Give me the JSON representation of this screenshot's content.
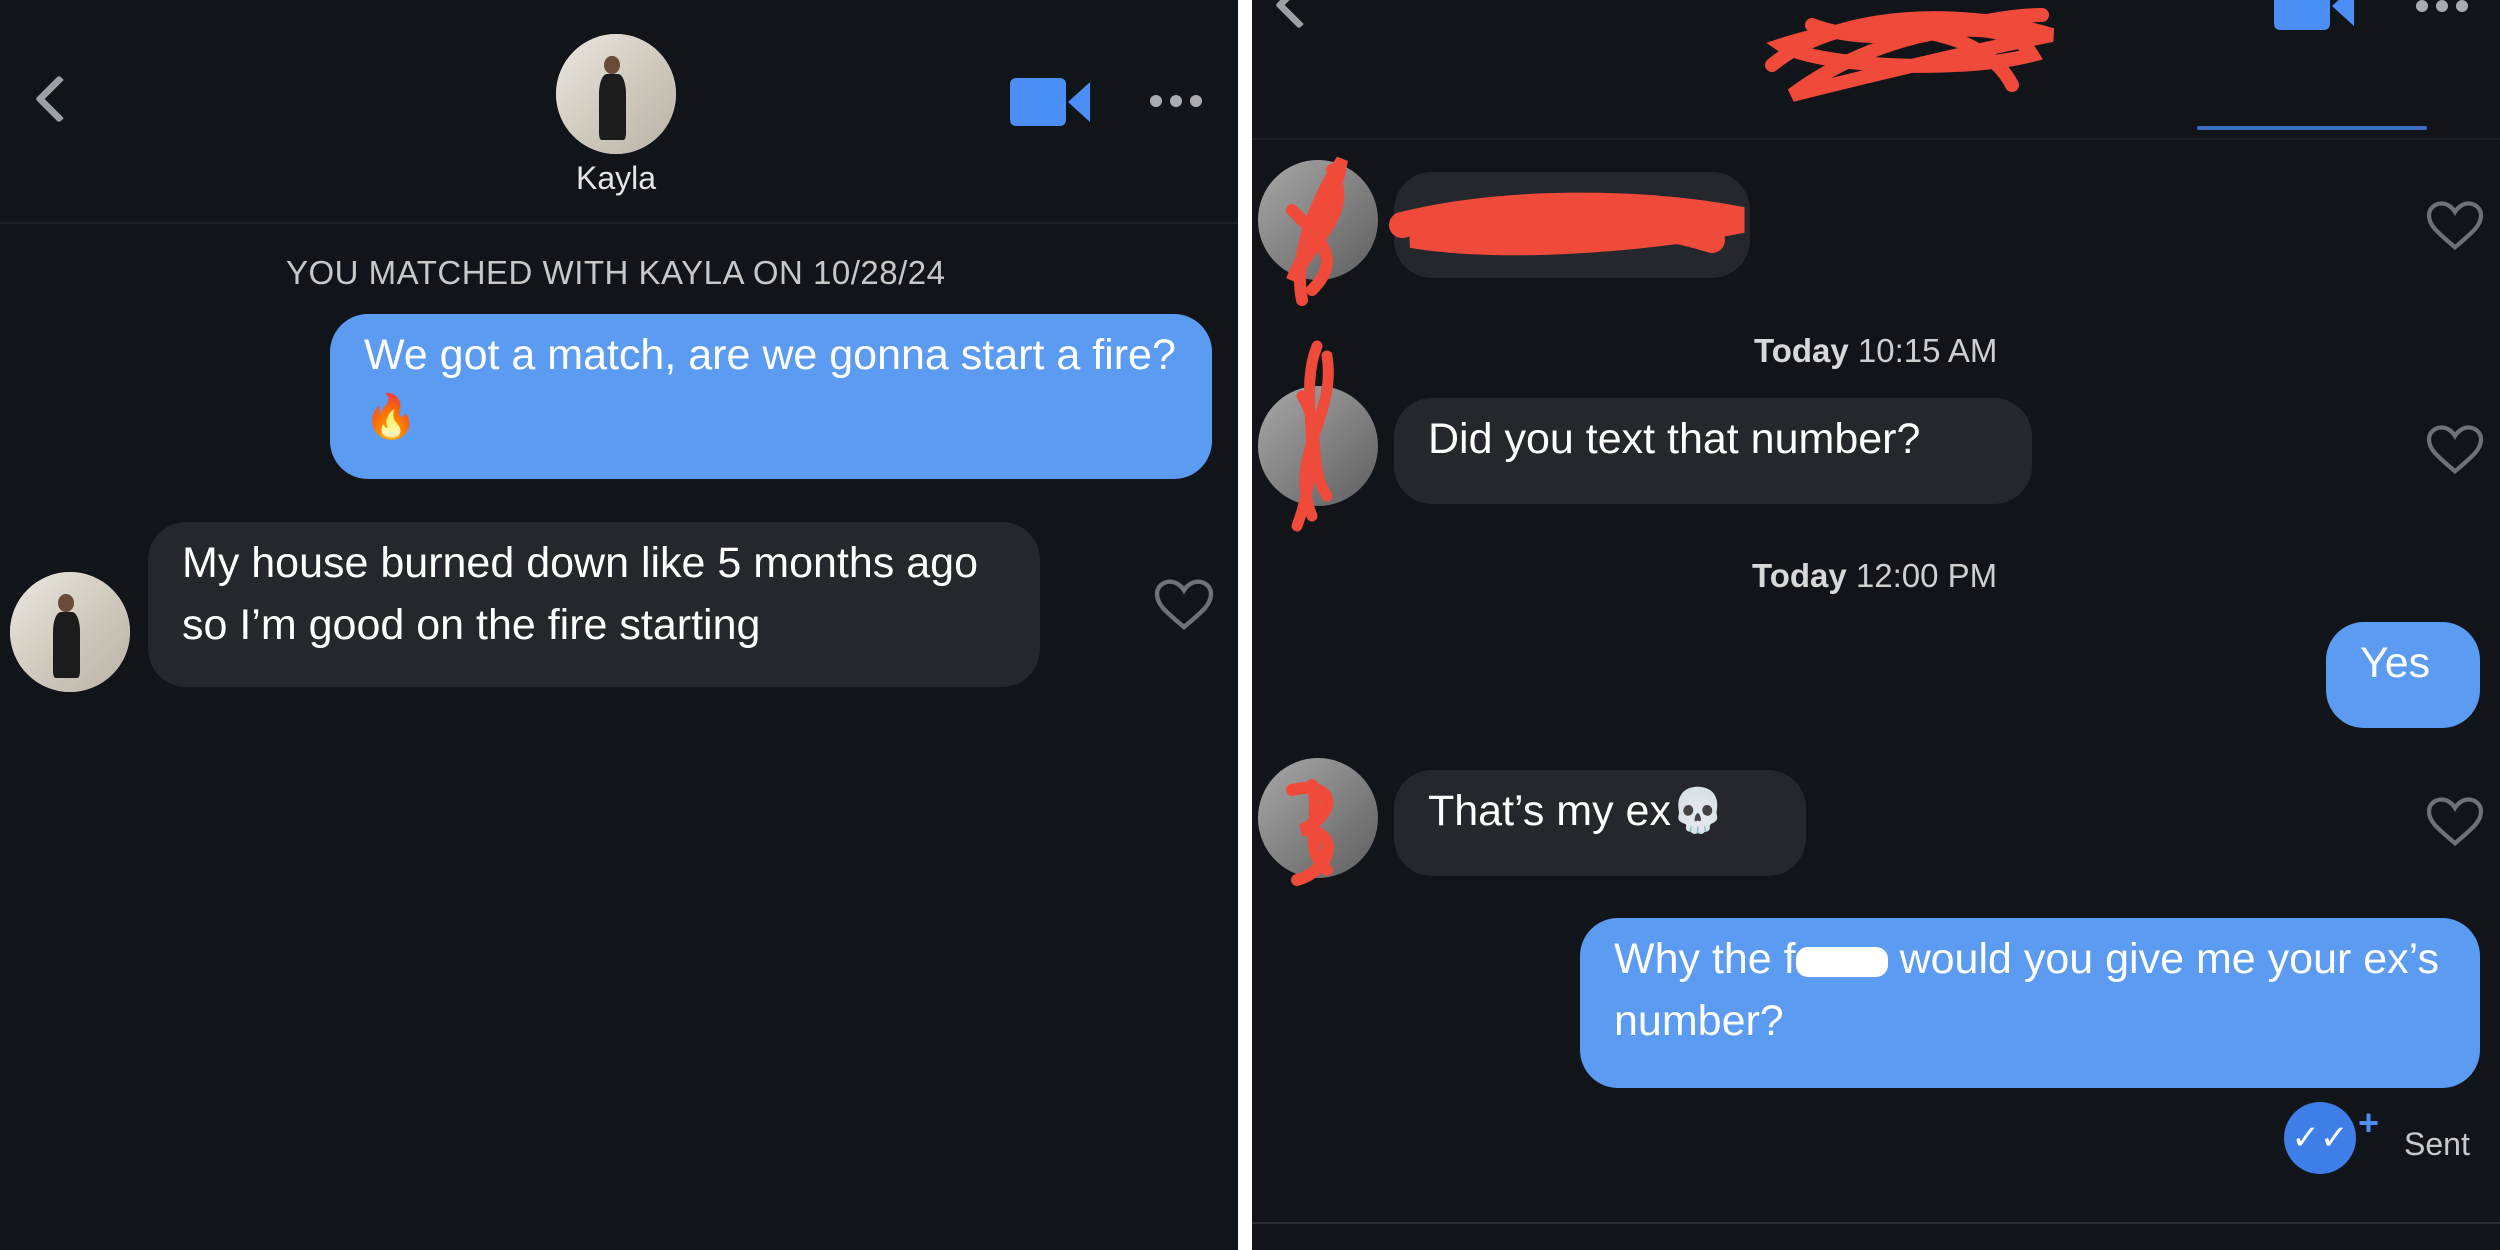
{
  "left": {
    "header": {
      "name": "Kayla",
      "back_icon": "chevron-left-icon",
      "video_icon": "video-camera-icon",
      "more_icon": "more-dots-icon"
    },
    "match_banner": "YOU MATCHED WITH KAYLA ON 10/28/24",
    "messages": [
      {
        "direction": "sent",
        "text": "We got a match, are we gonna start a fire?",
        "emoji": "🔥"
      },
      {
        "direction": "received",
        "text": "My house burned down like 5 months ago so I’m good on the fire starting"
      }
    ]
  },
  "right": {
    "messages_top": {
      "direction": "received",
      "text": "",
      "note": "censored"
    },
    "ts1": {
      "day": "Today",
      "time": "10:15 AM"
    },
    "msg_did_you_text": "Did you text that number?",
    "ts2": {
      "day": "Today",
      "time": "12:00 PM"
    },
    "msg_yes": "Yes",
    "msg_ex": "That’s my ex",
    "msg_ex_emoji": "💀",
    "msg_why_part1": "Why the f",
    "msg_why_part2": " would you give me your ex’s number?",
    "status": "Sent",
    "status_icon": "double-check-icon",
    "plus_label": "+"
  },
  "colors": {
    "background": "#111418",
    "sent_bubble": "#5b9bf2",
    "received_bubble": "#24272c",
    "accent": "#4b8ef5",
    "censor_red": "#f04a3a"
  }
}
